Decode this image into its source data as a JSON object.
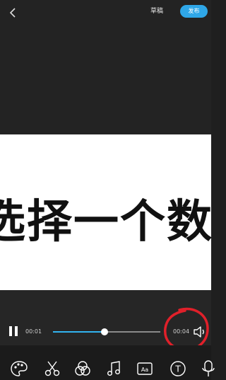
{
  "header": {
    "back_icon": "chevron-left-icon",
    "draft_label": "草稿",
    "publish_label": "发布"
  },
  "preview": {
    "caption": "选择一个数"
  },
  "player": {
    "current_time": "00:01",
    "total_time": "00:04",
    "progress": 0.48,
    "pause_icon": "pause-icon",
    "volume_icon": "volume-icon"
  },
  "toolbar": {
    "tools": [
      "palette-icon",
      "scissors-icon",
      "filter-icon",
      "music-icon",
      "subtitle-icon",
      "text-icon",
      "microphone-icon"
    ],
    "subtitle_glyph": "Aa",
    "text_glyph": "T"
  },
  "colors": {
    "accent": "#2fa7e8",
    "progress": "#31b3f0",
    "annotation": "#e0202a"
  }
}
